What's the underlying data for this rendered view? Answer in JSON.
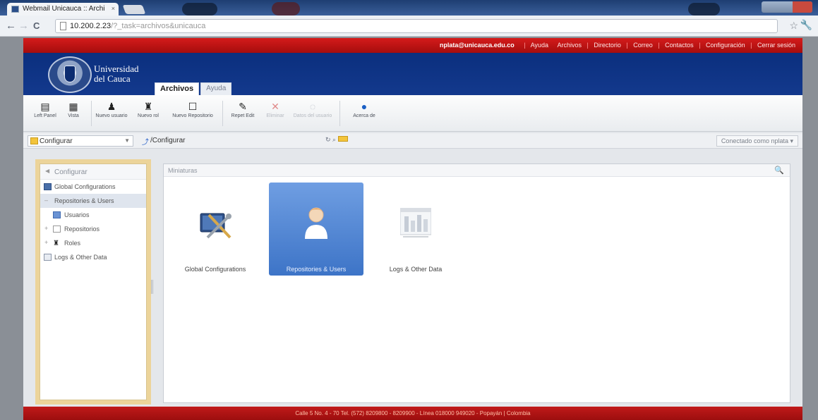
{
  "browser": {
    "tab_title": "Webmail Unicauca :: Archi",
    "tab_close": "×",
    "url_host": "10.200.2.23",
    "url_path": "/?_task=archivos&unicauca",
    "back": "←",
    "forward": "→",
    "reload": "C"
  },
  "top_strip": {
    "user": "nplata@unicauca.edu.co",
    "links": [
      "Ayuda",
      "Archivos",
      "Directorio",
      "Correo",
      "Contactos",
      "Configuración",
      "Cerrar sesión"
    ]
  },
  "header": {
    "university_line1": "Universidad",
    "university_line2": "del Cauca",
    "tabs": [
      "Archivos",
      "Ayuda"
    ]
  },
  "toolbar": {
    "actions": [
      {
        "label": "Left Panel",
        "icon": "panel-icon"
      },
      {
        "label": "Vista",
        "icon": "view-icon"
      },
      {
        "label": "Nuevo usuario",
        "icon": "user-icon"
      },
      {
        "label": "Nuevo rol",
        "icon": "group-icon"
      },
      {
        "label": "Nuevo Repositorio",
        "icon": "repository-icon"
      },
      {
        "label": "Repet Edit",
        "icon": "edit-icon"
      },
      {
        "label": "Eliminar",
        "icon": "delete-icon"
      },
      {
        "label": "Datos del usuario",
        "icon": "user-data-icon"
      },
      {
        "label": "Acerca de",
        "icon": "info-icon"
      }
    ]
  },
  "address": {
    "repository": "Configurar",
    "path": "/Configurar",
    "session": "Conectado como nplata"
  },
  "tree": {
    "header": "Configurar",
    "items": [
      {
        "label": "Global Configurations",
        "level": 0
      },
      {
        "label": "Repositories & Users",
        "level": 0
      },
      {
        "label": "Usuarios",
        "level": 1
      },
      {
        "label": "Repositorios",
        "level": 1
      },
      {
        "label": "Roles",
        "level": 1
      },
      {
        "label": "Logs & Other Data",
        "level": 0
      }
    ]
  },
  "main": {
    "header": "Miniaturas",
    "thumbnails": [
      {
        "label": "Global Configurations",
        "selected": false
      },
      {
        "label": "Repositories & Users",
        "selected": true
      },
      {
        "label": "Logs & Other Data",
        "selected": false
      }
    ]
  },
  "footer": {
    "text": "Calle 5 No. 4 - 70 Tel. (572) 8209800 - 8209900 - Línea 018000 949020 - Popayán | Colombia"
  }
}
